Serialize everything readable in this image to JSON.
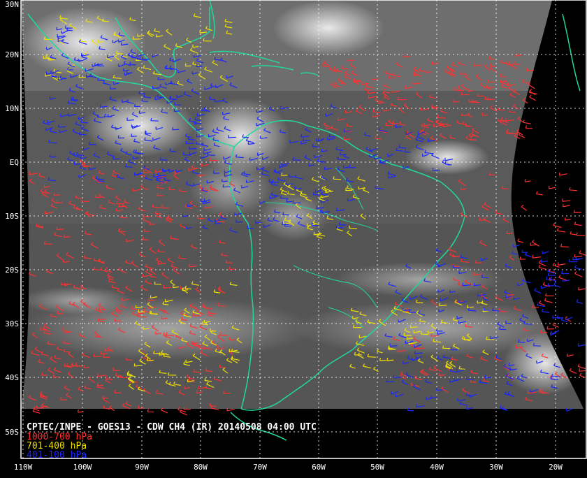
{
  "map": {
    "caption": "CPTEC/INPE - GOES13 - CDW CH4 (IR) 20140508 04:00 UTC",
    "legend": [
      {
        "label": "1000-700 hPa",
        "color": "#ff3030"
      },
      {
        "label": "701-400 hPa",
        "color": "#f0e000"
      },
      {
        "label": "401-100 hPa",
        "color": "#1a28ff"
      }
    ],
    "lat_labels": [
      "30N",
      "20N",
      "10N",
      "EQ",
      "10S",
      "20S",
      "30S",
      "40S",
      "50S"
    ],
    "lon_labels": [
      "110W",
      "100W",
      "90W",
      "80W",
      "70W",
      "60W",
      "50W",
      "40W",
      "30W",
      "20W"
    ],
    "colors": {
      "background": "#000000",
      "coastline": "#20d8a0",
      "grid": "#ffffff",
      "frame": "#ffffff"
    }
  }
}
